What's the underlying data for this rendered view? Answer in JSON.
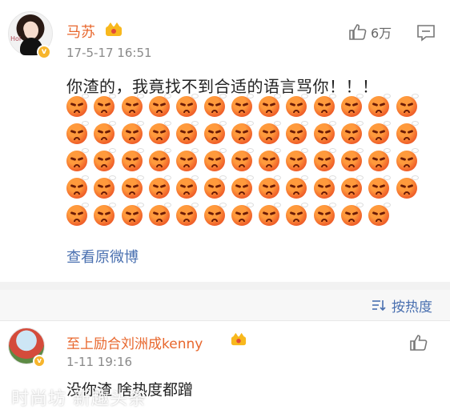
{
  "post": {
    "username": "马苏",
    "timestamp": "17-5-17 16:51",
    "likes": "6万",
    "text": "你渣的，我竟找不到合适的语言骂你！！！",
    "emoji_count": 64,
    "emoji_name": "angry-face",
    "view_original": "查看原微博",
    "avatar_text": "Hol"
  },
  "sort": {
    "label": "按热度"
  },
  "comment": {
    "username": "至上励合刘洲成kenny",
    "timestamp": "1-11 19:16",
    "text": "没你渣 啥热度都蹭"
  },
  "watermark": "时尚坊 新趣头条",
  "colors": {
    "username": "#e8672d",
    "link": "#4a70b0",
    "verified": "#f7b52c"
  }
}
